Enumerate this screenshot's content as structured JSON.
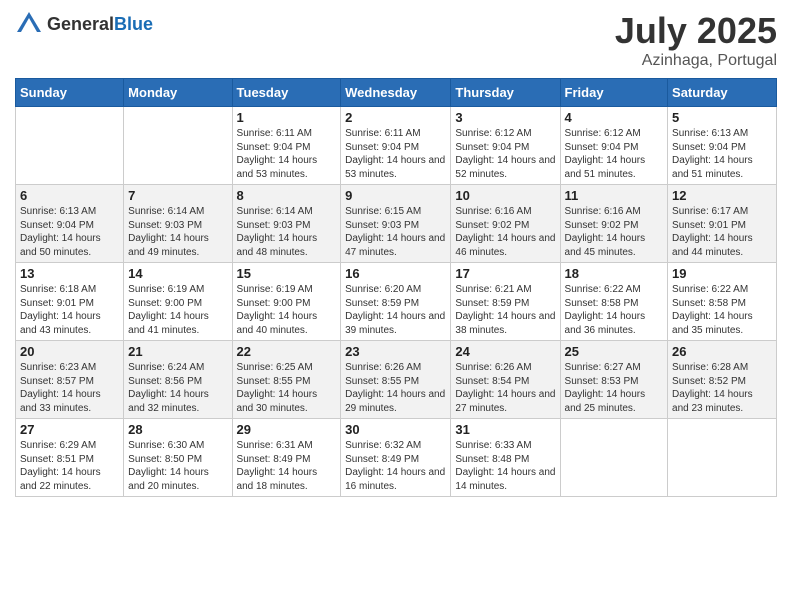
{
  "header": {
    "logo_general": "General",
    "logo_blue": "Blue",
    "month": "July 2025",
    "location": "Azinhaga, Portugal"
  },
  "weekdays": [
    "Sunday",
    "Monday",
    "Tuesday",
    "Wednesday",
    "Thursday",
    "Friday",
    "Saturday"
  ],
  "weeks": [
    [
      {
        "day": "",
        "info": ""
      },
      {
        "day": "",
        "info": ""
      },
      {
        "day": "1",
        "info": "Sunrise: 6:11 AM\nSunset: 9:04 PM\nDaylight: 14 hours and 53 minutes."
      },
      {
        "day": "2",
        "info": "Sunrise: 6:11 AM\nSunset: 9:04 PM\nDaylight: 14 hours and 53 minutes."
      },
      {
        "day": "3",
        "info": "Sunrise: 6:12 AM\nSunset: 9:04 PM\nDaylight: 14 hours and 52 minutes."
      },
      {
        "day": "4",
        "info": "Sunrise: 6:12 AM\nSunset: 9:04 PM\nDaylight: 14 hours and 51 minutes."
      },
      {
        "day": "5",
        "info": "Sunrise: 6:13 AM\nSunset: 9:04 PM\nDaylight: 14 hours and 51 minutes."
      }
    ],
    [
      {
        "day": "6",
        "info": "Sunrise: 6:13 AM\nSunset: 9:04 PM\nDaylight: 14 hours and 50 minutes."
      },
      {
        "day": "7",
        "info": "Sunrise: 6:14 AM\nSunset: 9:03 PM\nDaylight: 14 hours and 49 minutes."
      },
      {
        "day": "8",
        "info": "Sunrise: 6:14 AM\nSunset: 9:03 PM\nDaylight: 14 hours and 48 minutes."
      },
      {
        "day": "9",
        "info": "Sunrise: 6:15 AM\nSunset: 9:03 PM\nDaylight: 14 hours and 47 minutes."
      },
      {
        "day": "10",
        "info": "Sunrise: 6:16 AM\nSunset: 9:02 PM\nDaylight: 14 hours and 46 minutes."
      },
      {
        "day": "11",
        "info": "Sunrise: 6:16 AM\nSunset: 9:02 PM\nDaylight: 14 hours and 45 minutes."
      },
      {
        "day": "12",
        "info": "Sunrise: 6:17 AM\nSunset: 9:01 PM\nDaylight: 14 hours and 44 minutes."
      }
    ],
    [
      {
        "day": "13",
        "info": "Sunrise: 6:18 AM\nSunset: 9:01 PM\nDaylight: 14 hours and 43 minutes."
      },
      {
        "day": "14",
        "info": "Sunrise: 6:19 AM\nSunset: 9:00 PM\nDaylight: 14 hours and 41 minutes."
      },
      {
        "day": "15",
        "info": "Sunrise: 6:19 AM\nSunset: 9:00 PM\nDaylight: 14 hours and 40 minutes."
      },
      {
        "day": "16",
        "info": "Sunrise: 6:20 AM\nSunset: 8:59 PM\nDaylight: 14 hours and 39 minutes."
      },
      {
        "day": "17",
        "info": "Sunrise: 6:21 AM\nSunset: 8:59 PM\nDaylight: 14 hours and 38 minutes."
      },
      {
        "day": "18",
        "info": "Sunrise: 6:22 AM\nSunset: 8:58 PM\nDaylight: 14 hours and 36 minutes."
      },
      {
        "day": "19",
        "info": "Sunrise: 6:22 AM\nSunset: 8:58 PM\nDaylight: 14 hours and 35 minutes."
      }
    ],
    [
      {
        "day": "20",
        "info": "Sunrise: 6:23 AM\nSunset: 8:57 PM\nDaylight: 14 hours and 33 minutes."
      },
      {
        "day": "21",
        "info": "Sunrise: 6:24 AM\nSunset: 8:56 PM\nDaylight: 14 hours and 32 minutes."
      },
      {
        "day": "22",
        "info": "Sunrise: 6:25 AM\nSunset: 8:55 PM\nDaylight: 14 hours and 30 minutes."
      },
      {
        "day": "23",
        "info": "Sunrise: 6:26 AM\nSunset: 8:55 PM\nDaylight: 14 hours and 29 minutes."
      },
      {
        "day": "24",
        "info": "Sunrise: 6:26 AM\nSunset: 8:54 PM\nDaylight: 14 hours and 27 minutes."
      },
      {
        "day": "25",
        "info": "Sunrise: 6:27 AM\nSunset: 8:53 PM\nDaylight: 14 hours and 25 minutes."
      },
      {
        "day": "26",
        "info": "Sunrise: 6:28 AM\nSunset: 8:52 PM\nDaylight: 14 hours and 23 minutes."
      }
    ],
    [
      {
        "day": "27",
        "info": "Sunrise: 6:29 AM\nSunset: 8:51 PM\nDaylight: 14 hours and 22 minutes."
      },
      {
        "day": "28",
        "info": "Sunrise: 6:30 AM\nSunset: 8:50 PM\nDaylight: 14 hours and 20 minutes."
      },
      {
        "day": "29",
        "info": "Sunrise: 6:31 AM\nSunset: 8:49 PM\nDaylight: 14 hours and 18 minutes."
      },
      {
        "day": "30",
        "info": "Sunrise: 6:32 AM\nSunset: 8:49 PM\nDaylight: 14 hours and 16 minutes."
      },
      {
        "day": "31",
        "info": "Sunrise: 6:33 AM\nSunset: 8:48 PM\nDaylight: 14 hours and 14 minutes."
      },
      {
        "day": "",
        "info": ""
      },
      {
        "day": "",
        "info": ""
      }
    ]
  ]
}
